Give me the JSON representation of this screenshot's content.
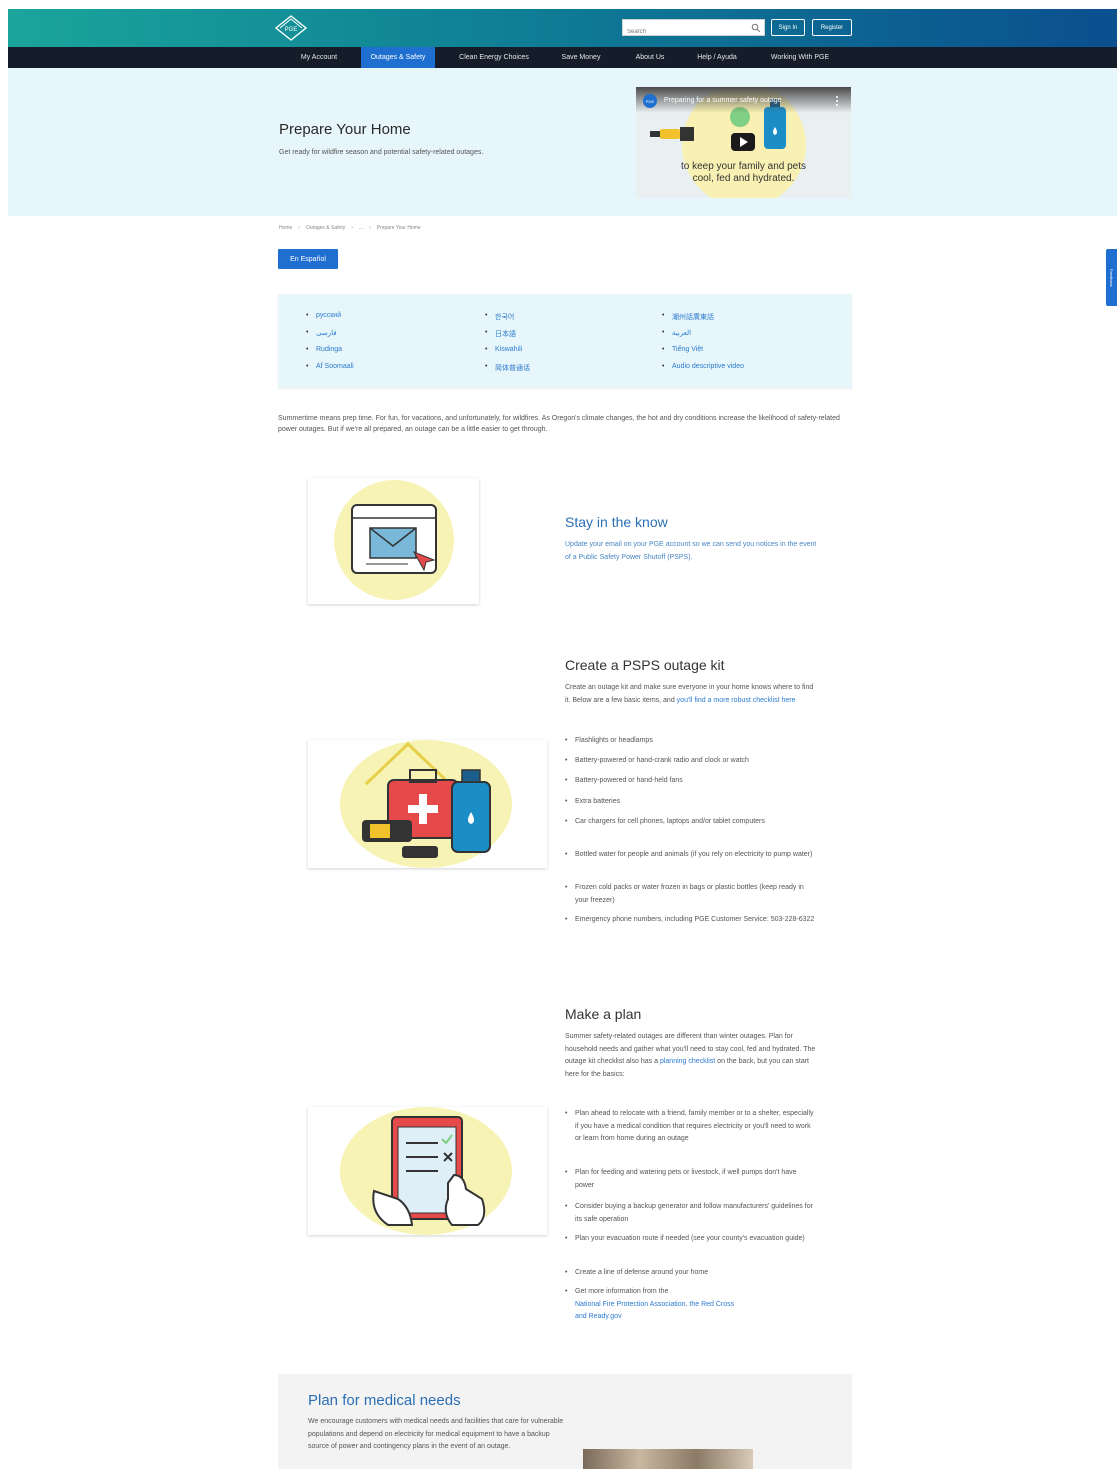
{
  "header": {
    "logo_text": "PGE",
    "search_placeholder": "Search",
    "signin_label": "Sign In",
    "register_label": "Register"
  },
  "nav": {
    "items": [
      "My Account",
      "Outages & Safety",
      "Clean Energy Choices",
      "Save Money",
      "About Us",
      "Help / Ayuda",
      "Working With PGE"
    ],
    "active_index": 1
  },
  "hero": {
    "title": "Prepare Your Home",
    "subtitle": "Get ready for wildfire season and potential safety-related outages.",
    "video_title": "Preparing for a summer safety outage",
    "video_caption": "to keep your family and pets cool, fed and hydrated."
  },
  "breadcrumb": [
    "Home",
    "Outages & Safety",
    "...",
    "Prepare Your Home"
  ],
  "espanol_label": "En Español",
  "languages": {
    "col1": [
      "русский",
      "فارسی",
      "Rudinga",
      "Af Soomaali"
    ],
    "col2": [
      "한국어",
      "日本語",
      "Kiswahili",
      "简体普通话"
    ],
    "col3": [
      "潮州話廣東話",
      "العربية",
      "Tiếng Việt",
      "Audio descriptive video"
    ]
  },
  "intro": "Summertime means prep time. For fun, for vacations, and unfortunately, for wildfires. As Oregon's climate changes, the hot and dry conditions increase the likelihood of safety-related power outages. But if we're all prepared, an outage can be a little easier to get through.",
  "stay": {
    "title": "Stay in the know",
    "body": "Update your email on your PGE account so we can send you notices in the event of a Public Safety Power Shutoff (PSPS)."
  },
  "kit": {
    "title": "Create a PSPS outage kit",
    "body1": "Create an outage kit and make sure everyone in your home knows where to find it. Below are a few basic items, and",
    "body_link": "you'll find a more robust checklist here",
    "items": [
      "Flashlights or headlamps",
      "Battery-powered or hand-crank radio and clock or watch",
      "Battery-powered or hand-held fans",
      "Extra batteries",
      "Car chargers for cell phones, laptops and/or tablet computers",
      "Bottled water for people and animals (if you rely on electricity to pump water)",
      "Frozen cold packs or water frozen in bags or plastic bottles (keep ready in your freezer)",
      "Emergency phone numbers, including PGE Customer Service: 503-228-6322"
    ]
  },
  "plan": {
    "title": "Make a plan",
    "body1": "Summer safety-related outages are different than winter outages. Plan for household needs and gather what you'll need to stay cool, fed and hydrated. The outage kit checklist also has a",
    "body_link": "planning checklist",
    "body2": "on the back, but you can start here for the basics:",
    "items": [
      "Plan ahead to relocate with a friend, family member or to a shelter, especially if you have a medical condition that requires electricity or you'll need to work or learn from home during an outage",
      "Plan for feeding and watering pets or livestock, if well pumps don't have power",
      "Consider buying a backup generator and follow manufacturers' guidelines for its safe operation",
      "Plan your evacuation route if needed (see your county's evacuation guide)",
      "Create a line of defense around your home",
      "Get more information from the"
    ],
    "links": [
      "National Fire Protection Association,",
      "the Red Cross",
      "and Ready.gov"
    ]
  },
  "medical": {
    "title": "Plan for medical needs",
    "body": "We encourage customers with medical needs and facilities that care for vulnerable populations and depend on electricity for medical equipment to have a backup source of power and contingency plans in the event of an outage."
  },
  "feedback_label": "Feedback",
  "colors": {
    "accent_blue": "#1f6fd1",
    "nav_dark": "#151d2b",
    "hero_bg": "#e7f6fa",
    "illustration_yellow": "#f7f3b5"
  }
}
